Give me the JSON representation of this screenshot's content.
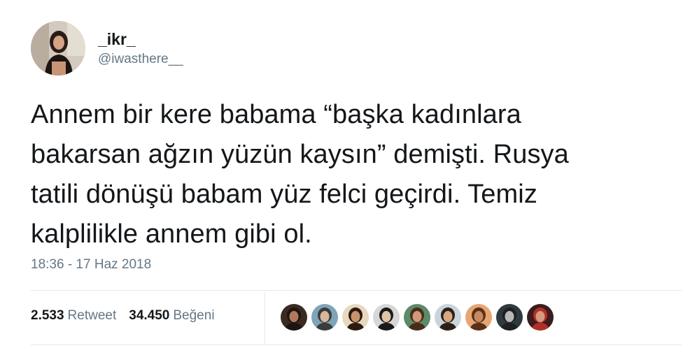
{
  "author": {
    "display_name": "_ikr_",
    "handle": "@iwasthere__"
  },
  "tweet": {
    "text": "Annem bir kere babama “başka kadınlara\nbakarsan ağzın yüzün kaysın” demişti. Rusya\ntatili dönüşü babam yüz felci geçirdi. Temiz\nkalplilikle annem gibi ol.",
    "timestamp": "18:36 - 17 Haz 2018"
  },
  "stats": {
    "retweet_count": "2.533",
    "retweet_label": "Retweet",
    "like_count": "34.450",
    "like_label": "Beğeni"
  },
  "likers": [
    {
      "name": "liker-avatar-1",
      "bg": "#3a2a22",
      "skin": "#b07a5a",
      "hair": "#1e1410"
    },
    {
      "name": "liker-avatar-2",
      "bg": "#7fa4b8",
      "skin": "#d8b89a",
      "hair": "#3b3b3b"
    },
    {
      "name": "liker-avatar-3",
      "bg": "#e8d8c0",
      "skin": "#c8926a",
      "hair": "#2a1a12"
    },
    {
      "name": "liker-avatar-4",
      "bg": "#d7d7d7",
      "skin": "#e1c3a8",
      "hair": "#1a1a1a"
    },
    {
      "name": "liker-avatar-5",
      "bg": "#5c8a6a",
      "skin": "#d09a78",
      "hair": "#4a2c1a"
    },
    {
      "name": "liker-avatar-6",
      "bg": "#c9d4dc",
      "skin": "#d6a884",
      "hair": "#2b2018"
    },
    {
      "name": "liker-avatar-7",
      "bg": "#e6a673",
      "skin": "#c88864",
      "hair": "#5a3018"
    },
    {
      "name": "liker-avatar-8",
      "bg": "#2e3a3e",
      "skin": "#b8b8b8",
      "hair": "#202020"
    },
    {
      "name": "liker-avatar-9",
      "bg": "#3c1c1c",
      "skin": "#d49a80",
      "hair": "#b03028"
    }
  ]
}
